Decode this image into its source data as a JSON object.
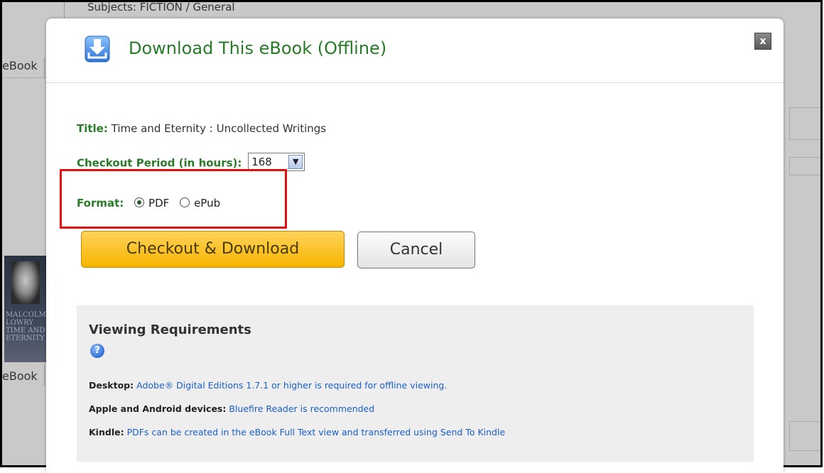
{
  "background": {
    "subjects_text": "Subjects: FICTION / General",
    "ebook_label_1": "eBook",
    "ebook_label_2": "eBook",
    "cover_text": "MALCOLM LOWRY TIME AND ETERNITY"
  },
  "modal": {
    "title": "Download This eBook (Offline)",
    "close_label": "x",
    "title_field": {
      "label": "Title:",
      "value": "Time and Eternity : Uncollected Writings"
    },
    "period_field": {
      "label": "Checkout Period (in hours):",
      "value": "168"
    },
    "format_field": {
      "label": "Format:",
      "options": [
        {
          "label": "PDF",
          "checked": true
        },
        {
          "label": "ePub",
          "checked": false
        }
      ]
    },
    "checkout_button": "Checkout & Download",
    "cancel_button": "Cancel",
    "requirements": {
      "title": "Viewing Requirements",
      "help_icon": "?",
      "lines": [
        {
          "label": "Desktop:",
          "text": "Adobe® Digital Editions 1.7.1 or higher is required for offline viewing."
        },
        {
          "label": "Apple and Android devices:",
          "text": "Bluefire Reader is recommended"
        },
        {
          "label": "Kindle:",
          "text": "PDFs can be created in the eBook Full Text view and transferred using Send To Kindle"
        }
      ]
    }
  },
  "colors": {
    "accent_green": "#2a7a2a",
    "checkout_yellow": "#f7b500",
    "link_blue": "#1a5fc9",
    "highlight_red": "#e01010"
  }
}
